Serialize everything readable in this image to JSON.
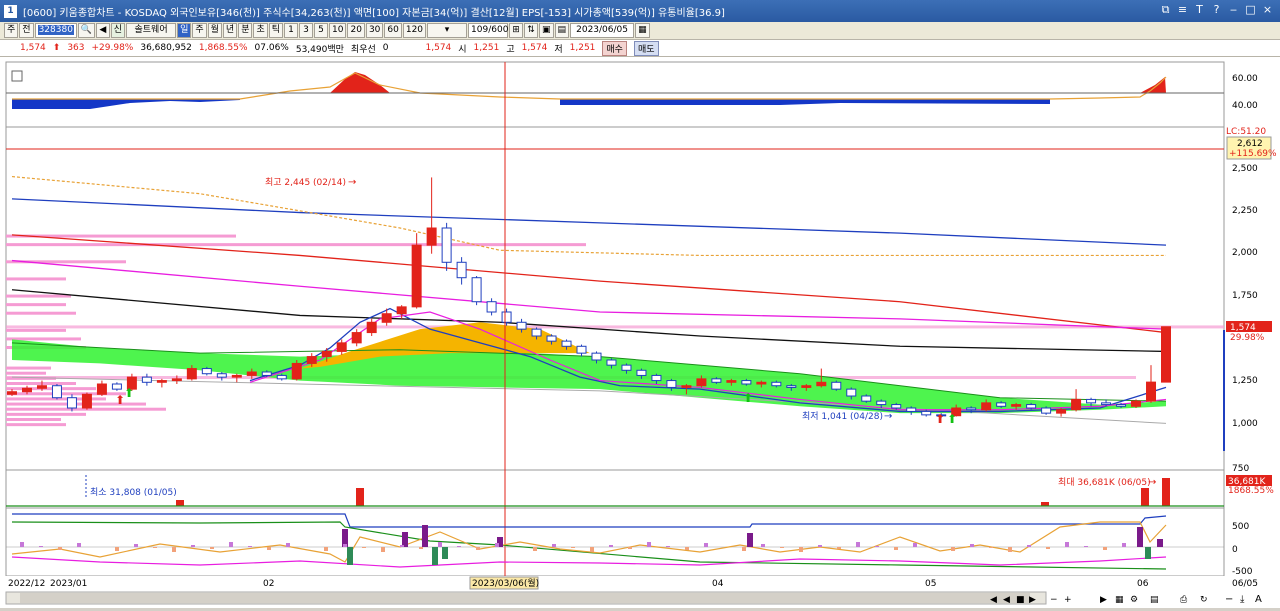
{
  "window": {
    "title": "[0600] 키움종합차트 - KOSDAQ 외국인보유[346(천)] 주식수[34,263(천)] 액면[100] 자본금[34(억)] 결산[12월] EPS[-153] 시가총액[539(억)] 유통비율[36.9]",
    "icon": "1",
    "buttons": [
      "⧉",
      "≡",
      "T",
      "?",
      "‒",
      "□",
      "×"
    ]
  },
  "toolbar": {
    "items": [
      "주",
      "전",
      "",
      "",
      "신",
      "솔트웨어",
      "일",
      "주",
      "월",
      "년",
      "분",
      "초",
      "틱",
      "1",
      "3",
      "5",
      "10",
      "20",
      "30",
      "60",
      "120"
    ],
    "stock_code": "328380",
    "count": "109/600",
    "date": "2023/06/05"
  },
  "quote": {
    "price": "1,574",
    "change": "363",
    "change_pct": "+29.98%",
    "volume": "36,680,952",
    "volume_pct": "1,868.55%",
    "turnover": "07.06%",
    "amount": "53,490백만",
    "pref_label": "최우선",
    "pref_value": "0",
    "close": "1,574",
    "open_label": "시",
    "open": "1,251",
    "high_label": "고",
    "high": "1,574",
    "low_label": "저",
    "low": "1,251",
    "buy_button": "매수",
    "sell_button": "매도"
  },
  "chart_data": {
    "type": "candlestick",
    "x_labels": [
      "2022/12",
      "2023/01",
      "02",
      "03",
      "04",
      "05",
      "06",
      "06/05"
    ],
    "crosshair_date": "2023/03/06(월)",
    "price_axis": [
      "2,500",
      "2,250",
      "2,000",
      "1,750",
      "1,500",
      "1,250",
      "1,000",
      "750"
    ],
    "upper_axis": [
      "60.00",
      "40.00"
    ],
    "lower_axis": [
      "500",
      "0",
      "-500"
    ],
    "lc_label": "LC:51.20",
    "lc_value": "2,612",
    "lc_pct": "+115.69%",
    "current_price": "1,574",
    "current_pct": "29.98%",
    "high_annotation": "최고 2,445 (02/14)",
    "low_annotation": "최저 1,041 (04/28)",
    "volume_max_annotation": "최대 36,681K (06/05)",
    "volume_min_annotation": "최소 31,808 (01/05)",
    "volume_value": "36,681K",
    "volume_pct": "1868.55%",
    "candles": [
      [
        1180,
        1210,
        1170,
        1195
      ],
      [
        1195,
        1230,
        1180,
        1215
      ],
      [
        1215,
        1260,
        1200,
        1230
      ],
      [
        1230,
        1240,
        1150,
        1160
      ],
      [
        1160,
        1180,
        1080,
        1100
      ],
      [
        1100,
        1190,
        1090,
        1180
      ],
      [
        1180,
        1260,
        1170,
        1240
      ],
      [
        1240,
        1250,
        1200,
        1210
      ],
      [
        1210,
        1300,
        1200,
        1280
      ],
      [
        1280,
        1300,
        1230,
        1250
      ],
      [
        1250,
        1270,
        1220,
        1260
      ],
      [
        1260,
        1290,
        1240,
        1270
      ],
      [
        1270,
        1350,
        1260,
        1330
      ],
      [
        1330,
        1340,
        1290,
        1300
      ],
      [
        1300,
        1310,
        1260,
        1280
      ],
      [
        1280,
        1300,
        1250,
        1290
      ],
      [
        1290,
        1330,
        1270,
        1310
      ],
      [
        1310,
        1320,
        1280,
        1290
      ],
      [
        1290,
        1300,
        1260,
        1270
      ],
      [
        1270,
        1380,
        1260,
        1360
      ],
      [
        1360,
        1420,
        1340,
        1400
      ],
      [
        1400,
        1450,
        1370,
        1430
      ],
      [
        1430,
        1500,
        1410,
        1480
      ],
      [
        1480,
        1560,
        1460,
        1540
      ],
      [
        1540,
        1620,
        1520,
        1600
      ],
      [
        1600,
        1680,
        1580,
        1650
      ],
      [
        1650,
        1700,
        1620,
        1690
      ],
      [
        1690,
        2120,
        1680,
        2050
      ],
      [
        2050,
        2445,
        2000,
        2150
      ],
      [
        2150,
        2180,
        1900,
        1950
      ],
      [
        1950,
        1980,
        1820,
        1860
      ],
      [
        1860,
        1870,
        1700,
        1720
      ],
      [
        1720,
        1740,
        1640,
        1660
      ],
      [
        1660,
        1680,
        1580,
        1600
      ],
      [
        1600,
        1620,
        1540,
        1560
      ],
      [
        1560,
        1570,
        1500,
        1520
      ],
      [
        1520,
        1530,
        1470,
        1490
      ],
      [
        1490,
        1500,
        1440,
        1460
      ],
      [
        1460,
        1470,
        1400,
        1420
      ],
      [
        1420,
        1430,
        1360,
        1380
      ],
      [
        1380,
        1390,
        1330,
        1350
      ],
      [
        1350,
        1360,
        1300,
        1320
      ],
      [
        1320,
        1330,
        1270,
        1290
      ],
      [
        1290,
        1300,
        1240,
        1260
      ],
      [
        1260,
        1270,
        1200,
        1220
      ],
      [
        1220,
        1240,
        1180,
        1230
      ],
      [
        1230,
        1290,
        1220,
        1270
      ],
      [
        1270,
        1280,
        1240,
        1250
      ],
      [
        1250,
        1270,
        1230,
        1260
      ],
      [
        1260,
        1270,
        1230,
        1240
      ],
      [
        1240,
        1260,
        1220,
        1250
      ],
      [
        1250,
        1260,
        1220,
        1230
      ],
      [
        1230,
        1240,
        1200,
        1220
      ],
      [
        1220,
        1240,
        1200,
        1230
      ],
      [
        1230,
        1330,
        1220,
        1250
      ],
      [
        1250,
        1260,
        1200,
        1210
      ],
      [
        1210,
        1220,
        1150,
        1170
      ],
      [
        1170,
        1180,
        1130,
        1140
      ],
      [
        1140,
        1150,
        1100,
        1120
      ],
      [
        1120,
        1130,
        1090,
        1100
      ],
      [
        1100,
        1110,
        1060,
        1080
      ],
      [
        1080,
        1090,
        1050,
        1060
      ],
      [
        1060,
        1070,
        1041,
        1055
      ],
      [
        1055,
        1120,
        1050,
        1100
      ],
      [
        1100,
        1110,
        1070,
        1090
      ],
      [
        1090,
        1150,
        1080,
        1130
      ],
      [
        1130,
        1140,
        1100,
        1110
      ],
      [
        1110,
        1130,
        1090,
        1120
      ],
      [
        1120,
        1130,
        1090,
        1100
      ],
      [
        1100,
        1110,
        1060,
        1070
      ],
      [
        1070,
        1100,
        1050,
        1090
      ],
      [
        1090,
        1210,
        1080,
        1150
      ],
      [
        1150,
        1160,
        1110,
        1130
      ],
      [
        1130,
        1150,
        1110,
        1120
      ],
      [
        1120,
        1130,
        1100,
        1110
      ],
      [
        1110,
        1150,
        1100,
        1140
      ],
      [
        1140,
        1350,
        1130,
        1251
      ],
      [
        1251,
        1574,
        1251,
        1574
      ]
    ]
  }
}
